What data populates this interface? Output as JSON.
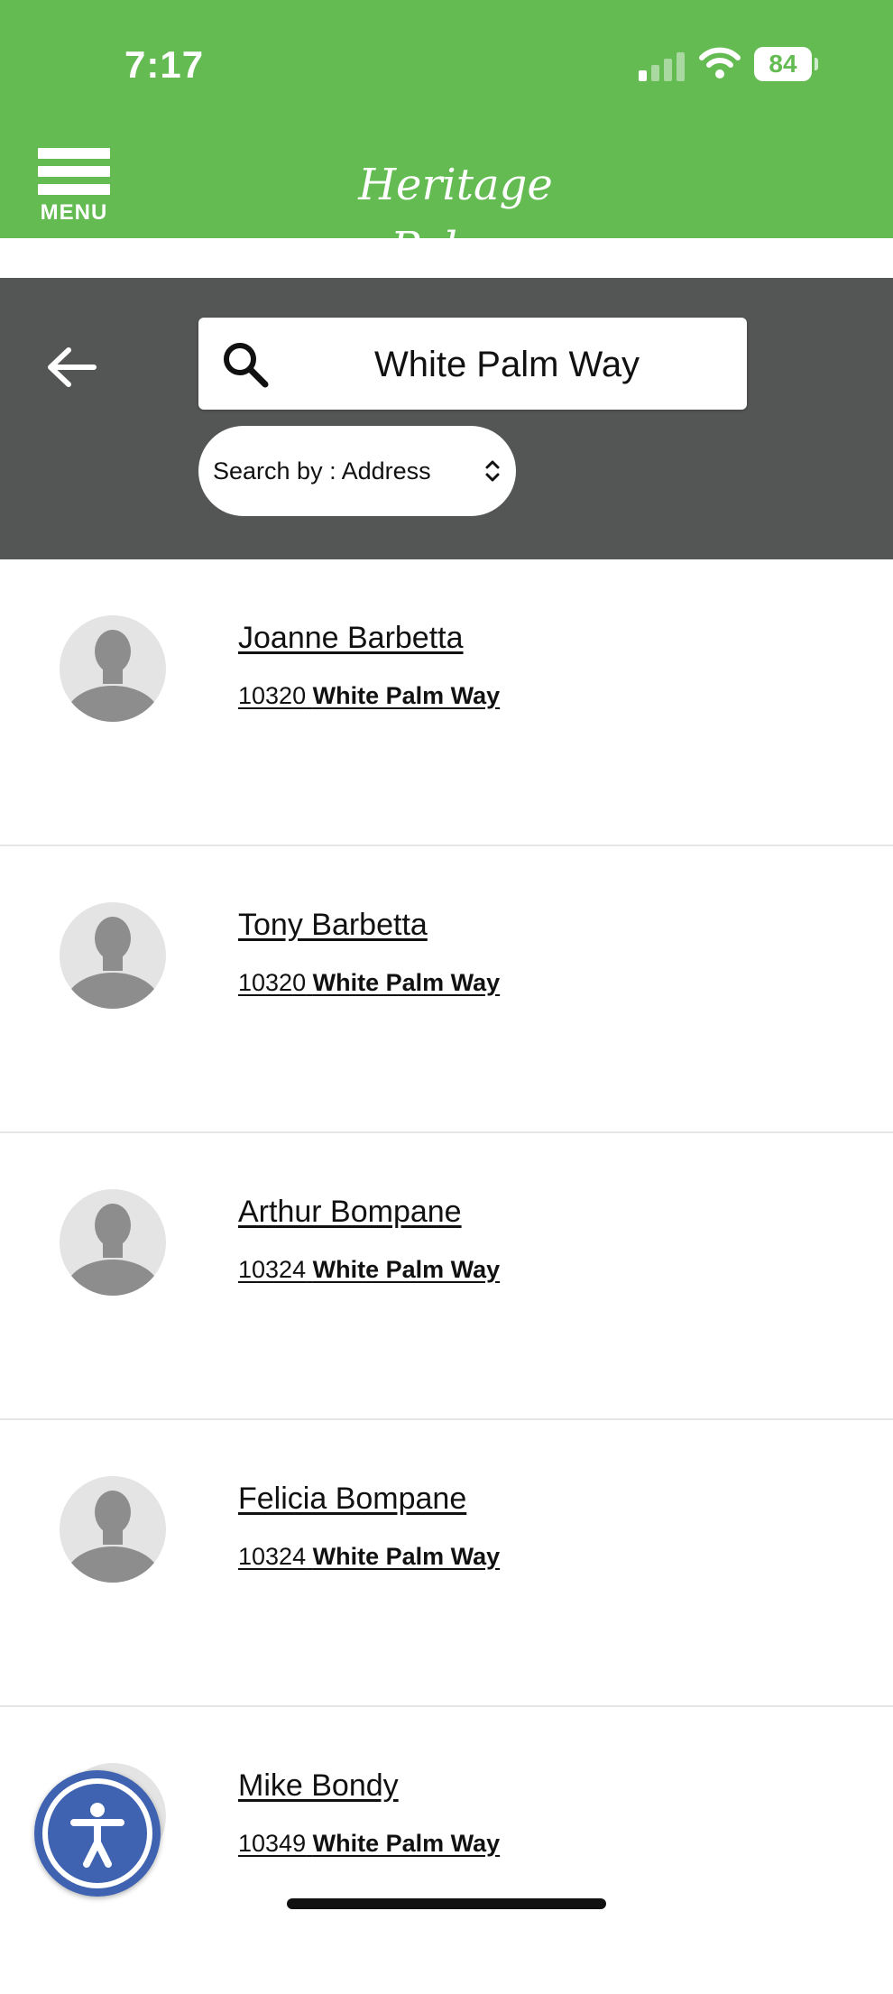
{
  "status_bar": {
    "time": "7:17",
    "battery": "84"
  },
  "header": {
    "menu_label": "MENU",
    "brand": "Heritage Palms"
  },
  "search": {
    "query": "White Palm Way",
    "search_by": "Search by : Address"
  },
  "residents": [
    {
      "name": "Joanne Barbetta",
      "number": "10320",
      "street": "White Palm Way"
    },
    {
      "name": "Tony Barbetta",
      "number": "10320",
      "street": "White Palm Way"
    },
    {
      "name": "Arthur Bompane",
      "number": "10324",
      "street": "White Palm Way"
    },
    {
      "name": "Felicia Bompane",
      "number": "10324",
      "street": "White Palm Way"
    },
    {
      "name": "Mike Bondy",
      "number": "10349",
      "street": "White Palm Way"
    }
  ],
  "icons": {
    "menu": "hamburger-icon",
    "back": "arrow-left-icon",
    "search": "search-icon",
    "select": "chevron-updown-icon",
    "avatar": "person-silhouette-icon",
    "accessibility": "accessibility-icon"
  },
  "colors": {
    "header_green": "#63bb52",
    "search_band": "#545555",
    "accessibility_blue": "#3f63b1"
  }
}
